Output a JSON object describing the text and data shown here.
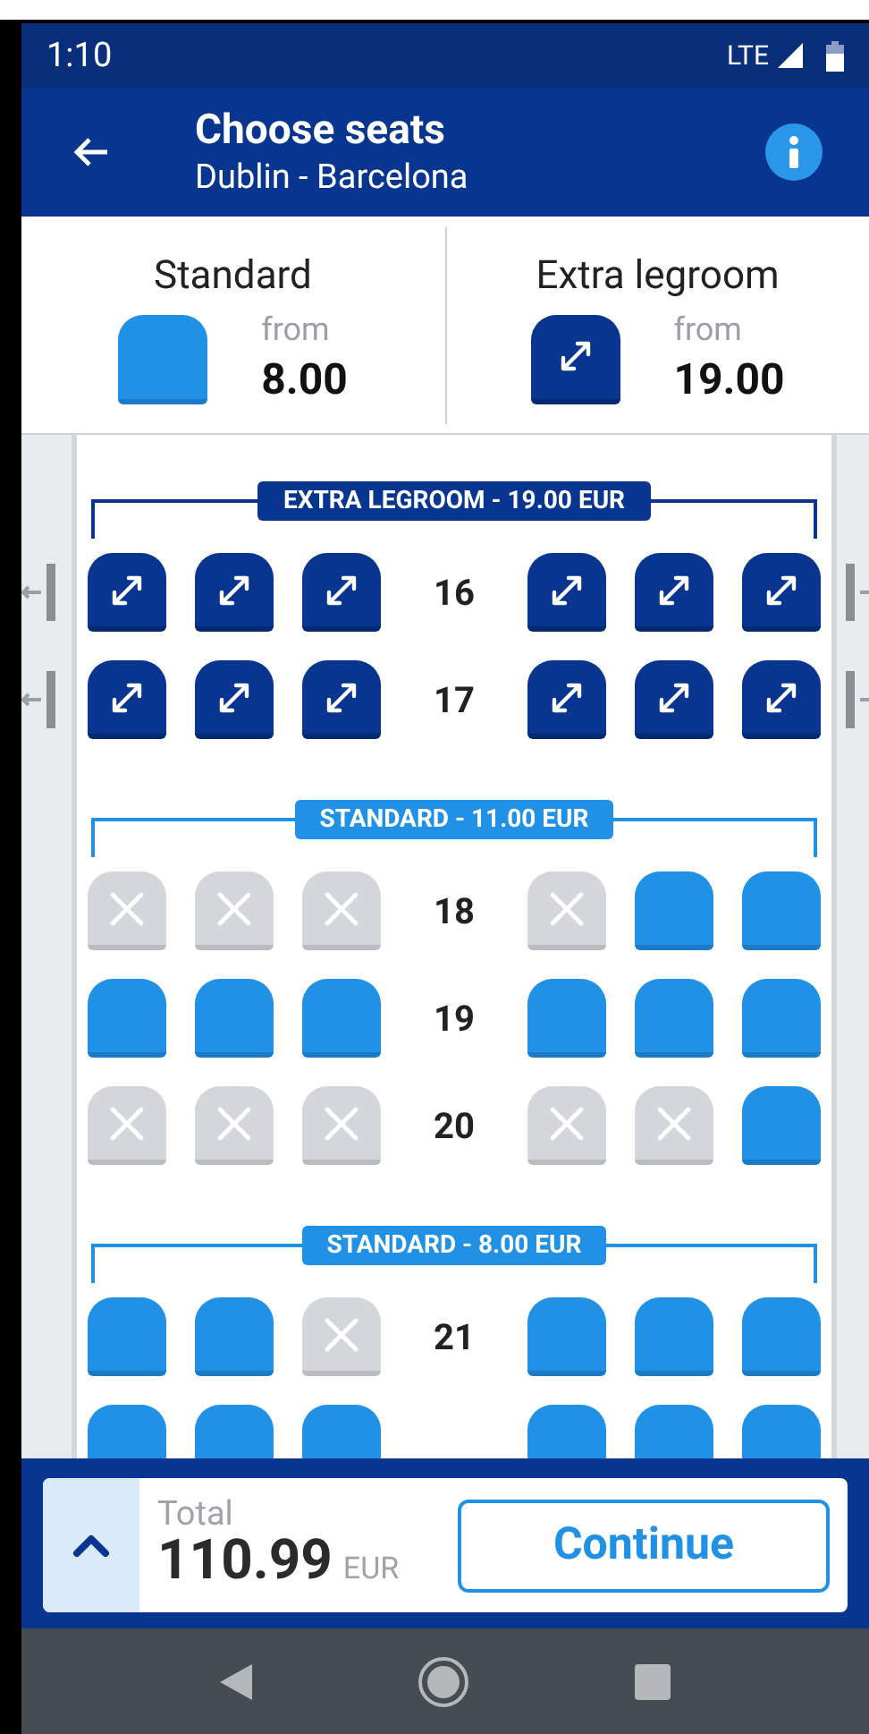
{
  "status_bar": {
    "time": "1:10",
    "network": "LTE"
  },
  "header": {
    "title": "Choose seats",
    "subtitle": "Dublin - Barcelona"
  },
  "classes": [
    {
      "kind": "standard",
      "name": "Standard",
      "from_label": "from",
      "price": "8.00"
    },
    {
      "kind": "extra",
      "name": "Extra legroom",
      "from_label": "from",
      "price": "19.00"
    }
  ],
  "sections": [
    {
      "kind": "extra",
      "label": "EXTRA LEGROOM - 19.00 EUR",
      "rows": [
        {
          "number": "16",
          "exit": true,
          "seats": [
            {
              "occupied": false
            },
            {
              "occupied": false
            },
            {
              "occupied": false
            },
            {
              "occupied": false
            },
            {
              "occupied": false
            },
            {
              "occupied": false
            }
          ]
        },
        {
          "number": "17",
          "exit": true,
          "seats": [
            {
              "occupied": false
            },
            {
              "occupied": false
            },
            {
              "occupied": false
            },
            {
              "occupied": false
            },
            {
              "occupied": false
            },
            {
              "occupied": false
            }
          ]
        }
      ]
    },
    {
      "kind": "standard",
      "label": "STANDARD - 11.00 EUR",
      "rows": [
        {
          "number": "18",
          "exit": false,
          "seats": [
            {
              "occupied": true
            },
            {
              "occupied": true
            },
            {
              "occupied": true
            },
            {
              "occupied": true
            },
            {
              "occupied": false
            },
            {
              "occupied": false
            }
          ]
        },
        {
          "number": "19",
          "exit": false,
          "seats": [
            {
              "occupied": false
            },
            {
              "occupied": false
            },
            {
              "occupied": false
            },
            {
              "occupied": false
            },
            {
              "occupied": false
            },
            {
              "occupied": false
            }
          ]
        },
        {
          "number": "20",
          "exit": false,
          "seats": [
            {
              "occupied": true
            },
            {
              "occupied": true
            },
            {
              "occupied": true
            },
            {
              "occupied": true
            },
            {
              "occupied": true
            },
            {
              "occupied": false
            }
          ]
        }
      ]
    },
    {
      "kind": "standard",
      "label": "STANDARD - 8.00 EUR",
      "rows": [
        {
          "number": "21",
          "exit": false,
          "seats": [
            {
              "occupied": false
            },
            {
              "occupied": false
            },
            {
              "occupied": true
            },
            {
              "occupied": false
            },
            {
              "occupied": false
            },
            {
              "occupied": false
            }
          ]
        },
        {
          "exit": false,
          "seats": [
            {
              "occupied": false
            },
            {
              "occupied": false
            },
            {
              "occupied": false
            },
            {
              "occupied": false
            },
            {
              "occupied": false
            },
            {
              "occupied": false
            }
          ]
        }
      ]
    }
  ],
  "footer": {
    "total_label": "Total",
    "total": "110.99",
    "currency": "EUR",
    "button": "Continue"
  }
}
